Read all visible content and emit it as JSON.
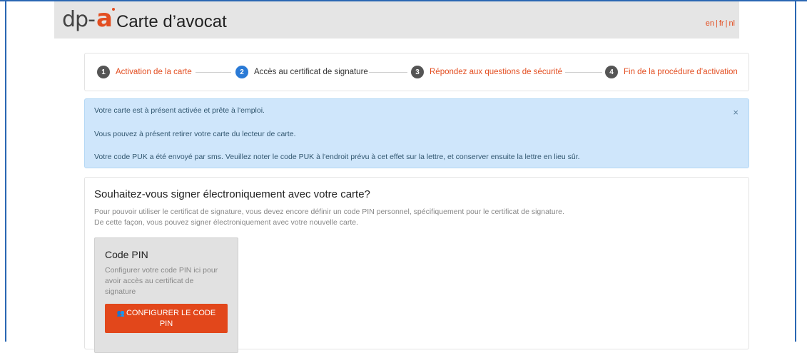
{
  "header": {
    "logo_dp": "dp-",
    "logo_a": "a",
    "title": "Carte d’avocat",
    "languages": [
      "en",
      "fr",
      "nl"
    ],
    "language_separator": "|"
  },
  "steps": [
    {
      "number": "1",
      "label": "Activation de la carte",
      "active": false
    },
    {
      "number": "2",
      "label": "Accès au certificat de signature",
      "active": true
    },
    {
      "number": "3",
      "label": "Répondez aux questions de sécurité",
      "active": false
    },
    {
      "number": "4",
      "label": "Fin de la procédure d’activation",
      "active": false
    }
  ],
  "alert": {
    "line1": "Votre carte est à présent activée et prête à l'emploi.",
    "line2": "Vous pouvez à présent retirer votre carte du lecteur de carte.",
    "line3": "Votre code PUK a été envoyé par sms. Veuillez noter le code PUK à l'endroit prévu à cet effet sur la lettre, et conserver ensuite la lettre en lieu sûr.",
    "close": "×"
  },
  "signature": {
    "title": "Souhaitez-vous signer électroniquement avec votre carte?",
    "desc1": "Pour pouvoir utiliser le certificat de signature, vous devez encore définir un code PIN personnel, spécifiquement pour le certificat de signature.",
    "desc2": "De cette façon, vous pouvez signer électroniquement avec votre nouvelle carte."
  },
  "pin_card": {
    "title": "Code PIN",
    "desc": "Configurer votre code PIN ici pour avoir accès au certificat de signature",
    "button_icon": "users-icon",
    "button_label": "CONFIGURER LE CODE PIN"
  },
  "colors": {
    "accent": "#e34e21",
    "active_step": "#2a7ad6",
    "alert_bg": "#cfe6fb",
    "frame": "#2a67b3"
  }
}
